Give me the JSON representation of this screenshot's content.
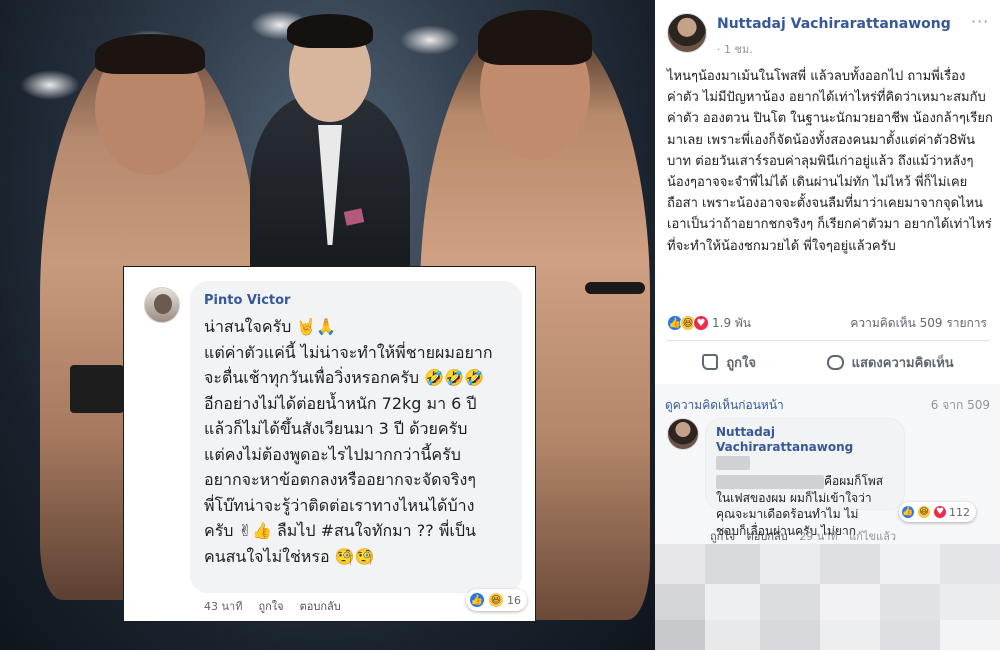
{
  "colors": {
    "link_blue": "#365899",
    "like_blue": "#2078f4",
    "love_red": "#f0284a",
    "haha_yellow": "#f7c74d",
    "meta_gray": "#90949c"
  },
  "poster": {
    "comment": {
      "author": "Pinto Victor",
      "text": "น่าสนใจครับ 🤘🙏\nแต่ค่าตัวแค่นี้ ไม่น่าจะทำให้พี่ชายผมอยาก\nจะตื่นเช้าทุกวันเพื่อวิ่งหรอกครับ 🤣🤣🤣\nอีกอย่างไม่ได้ต่อยน้ำหนัก 72kg มา 6 ปี\nแล้วก็ไม่ได้ขึ้นสังเวียนมา 3 ปี ด้วยครับ\nแต่คงไม่ต้องพูดอะไรไปมากกว่านี้ครับ\nอยากจะหาข้อตกลงหรืออยากจะจัดจริงๆ\nพี่โบ๊ทน่าจะรู้ว่าติดต่อเราทางไหนได้บ้าง\nครับ ✌👍 ลืมไป #สนใจทักมา ?? พี่เป็น\nคนสนใจไม่ใช่หรอ 🧐🧐",
      "time": "43 นาที",
      "like_label": "ถูกใจ",
      "reply_label": "ตอบกลับ",
      "reaction_count": "16",
      "reactions": [
        "like-icon",
        "haha-icon"
      ]
    }
  },
  "post": {
    "author": "Nuttadaj Vachirarattanawong",
    "time": "· 1 ชม.",
    "more": "···",
    "body": "ไหนๆน้องมาเม้นในโพสพี่ แล้วลบทั้งออกไป ถามพี่เรื่องค่าตัว ไม่มีปัญหาน้อง อยากได้เท่าไหร่ที่คิดว่าเหมาะสมกับค่าตัว อองตวน ปินโต ในฐานะนักมวยอาชีพ น้องกล้าๆเรียกมาเลย เพราะพี่เองก็จัดน้องทั้งสองคนมาตั้งแต่ค่าตัว8พันบาท ต่อยวันเสาร์รอบค่าลุมพินีเก่าอยู่แล้ว ถึงแม้ว่าหลังๆน้องๆอาจจะจำพี่ไม่ได้ เดินผ่านไม่ทัก ไม่ไหว้ พี่ก็ไม่เคยถือสา เพราะน้องอาจจะตั้งจนลืมที่มาว่าเคยมาจากจุดไหน เอาเป็นว่าถ้าอยากชกจริงๆ ก็เรียกค่าตัวมา อยากได้เท่าไหร่ที่จะทำให้น้องชกมวยได้ พี่ใจๆอยู่แล้วครับ",
    "reaction_count": "1.9 พัน",
    "comment_count": "ความคิดเห็น 509 รายการ",
    "reactions": [
      "like-icon",
      "haha-icon",
      "love-icon"
    ],
    "like_action": "ถูกใจ",
    "comment_action": "แสดงความคิดเห็น",
    "previous_comments": "ดูความคิดเห็นก่อนหน้า",
    "comments_paging": "6 จาก 509",
    "reply": {
      "author_line1": "Nuttadaj",
      "author_line2": "Vachirarattanawong",
      "text_line1": "คือผมก็โพส",
      "text_rest": "ในเฟสของผม ผมก็ไม่เข้าใจว่า\nคุณจะมาเดือดร้อนทำไม ไม่\nชอบก็เลื่อนผ่านครับ ไม่ยาก",
      "reaction_count": "112",
      "like_label": "ถูกใจ",
      "reply_label": "ตอบกลับ",
      "time": "29 นาที",
      "edited": "แก้ไขแล้ว"
    }
  }
}
